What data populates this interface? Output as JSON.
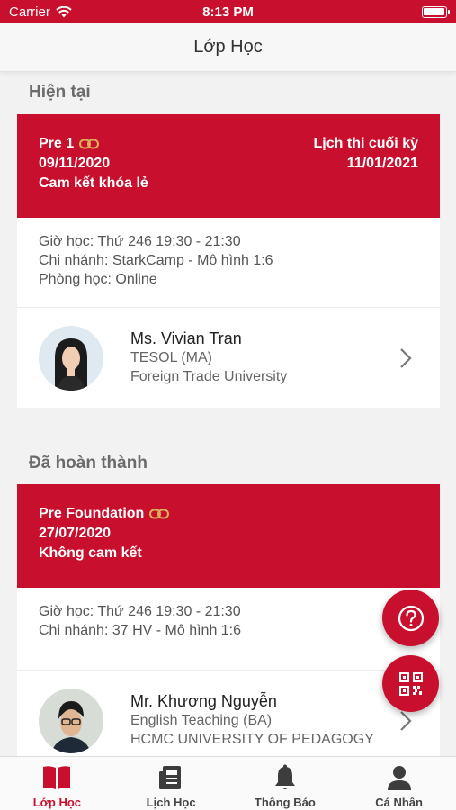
{
  "status_bar": {
    "carrier": "Carrier",
    "time": "8:13 PM"
  },
  "nav": {
    "title": "Lớp Học"
  },
  "sections": {
    "current_title": "Hiện tại",
    "completed_title": "Đã hoàn thành"
  },
  "current_class": {
    "name": "Pre 1",
    "start_date": "09/11/2020",
    "commitment": "Cam kết khóa lẻ",
    "exam_label": "Lịch thi cuối kỳ",
    "exam_date": "11/01/2021",
    "schedule": "Giờ học: Thứ 246 19:30 - 21:30",
    "branch": "Chi nhánh: StarkCamp  -  Mô hình 1:6",
    "room": "Phòng học: Online",
    "teacher": {
      "name": "Ms. Vivian Tran",
      "degree": "TESOL (MA)",
      "school": "Foreign Trade University"
    }
  },
  "completed_class": {
    "name": "Pre Foundation",
    "start_date": "27/07/2020",
    "commitment": "Không cam kết",
    "schedule": "Giờ học: Thứ 246 19:30 - 21:30",
    "branch": "Chi nhánh: 37 HV  -  Mô hình 1:6",
    "teacher": {
      "name": "Mr. Khương Nguyễn",
      "degree": "English Teaching (BA)",
      "school": "HCMC UNIVERSITY OF PEDAGOGY"
    }
  },
  "tabs": [
    {
      "label": "Lớp Học",
      "icon": "book-icon",
      "active": true
    },
    {
      "label": "Lịch Học",
      "icon": "schedule-icon",
      "active": false
    },
    {
      "label": "Thông Báo",
      "icon": "bell-icon",
      "active": false
    },
    {
      "label": "Cá Nhân",
      "icon": "person-icon",
      "active": false
    }
  ],
  "colors": {
    "accent": "#c8102e",
    "link_icon": "#d9b25a"
  }
}
